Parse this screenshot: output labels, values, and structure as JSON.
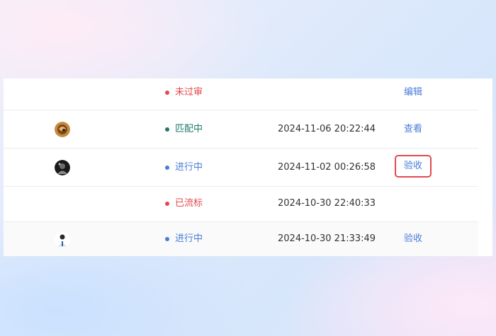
{
  "colors": {
    "status_red": "#e5484d",
    "status_green": "#1f7a6a",
    "status_blue": "#4a7dd8",
    "link": "#4a7dd8",
    "highlight_border": "#e5484d"
  },
  "rows": [
    {
      "status": "未过审",
      "status_color": "#e5484d",
      "time": "",
      "action": "编辑",
      "avatar": ""
    },
    {
      "status": "匹配中",
      "status_color": "#1f7a6a",
      "time": "2024-11-06 20:22:44",
      "action": "查看",
      "avatar": "brown-avatar"
    },
    {
      "status": "进行中",
      "status_color": "#4a7dd8",
      "time": "2024-11-02 00:26:58",
      "action": "验收",
      "avatar": "dark-avatar"
    },
    {
      "status": "已流标",
      "status_color": "#e5484d",
      "time": "2024-10-30 22:40:33",
      "action": "",
      "avatar": ""
    },
    {
      "status": "进行中",
      "status_color": "#4a7dd8",
      "time": "2024-10-30 21:33:49",
      "action": "验收",
      "avatar": "person-avatar"
    }
  ]
}
